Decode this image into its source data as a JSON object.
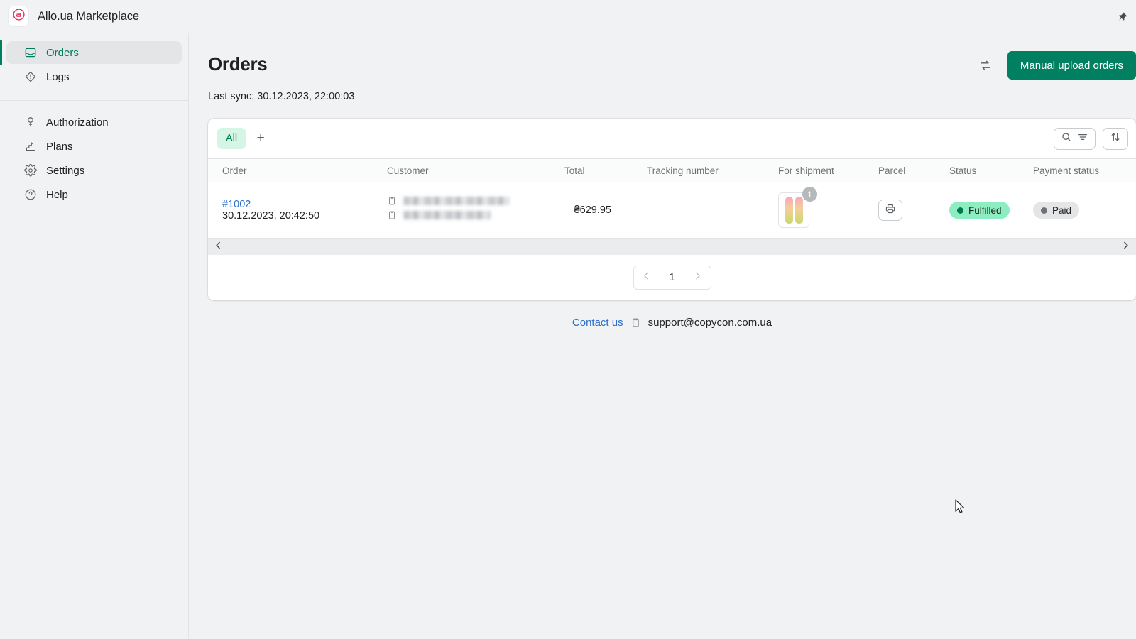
{
  "topbar": {
    "app_title": "Allo.ua Marketplace",
    "logo_icon": "allo-logo-icon",
    "logo_color": "#e8274b",
    "pin_icon": "pushpin-icon"
  },
  "sidebar": {
    "groups": [
      {
        "items": [
          {
            "label": "Orders",
            "icon": "inbox-icon",
            "active": true
          },
          {
            "label": "Logs",
            "icon": "alert-diamond-icon",
            "active": false
          }
        ]
      },
      {
        "items": [
          {
            "label": "Authorization",
            "icon": "key-icon",
            "active": false
          },
          {
            "label": "Plans",
            "icon": "stairs-chart-icon",
            "active": false
          },
          {
            "label": "Settings",
            "icon": "gear-icon",
            "active": false
          },
          {
            "label": "Help",
            "icon": "question-circle-icon",
            "active": false
          }
        ]
      }
    ],
    "accent_color": "#007f5f"
  },
  "page": {
    "title": "Orders",
    "last_sync": "Last sync: 30.12.2023, 22:00:03",
    "sync_icon": "sync-arrows-icon",
    "primary_button": "Manual upload orders",
    "primary_color": "#008060"
  },
  "tabs": {
    "items": [
      {
        "label": "All",
        "active": true
      }
    ],
    "add_label": "+",
    "search_icon": "search-icon",
    "filter_icon": "filter-lines-icon",
    "sort_icon": "sort-arrows-icon"
  },
  "table": {
    "columns": [
      "Order",
      "Customer",
      "Total",
      "Tracking number",
      "For shipment",
      "Parcel",
      "Status",
      "Payment status"
    ],
    "rows": [
      {
        "order_id": "#1002",
        "order_date": "30.12.2023, 20:42:50",
        "customer_name_redacted": true,
        "customer_contact_redacted": true,
        "total": "₴629.95",
        "tracking_redacted": true,
        "shipment_count": "1",
        "parcel_icon": "printer-icon",
        "status": "Fulfilled",
        "status_color": "#8ceec0",
        "payment_status": "Paid",
        "payment_color": "#e4e5e7",
        "copy_icon": "copy-clipboard-icon"
      }
    ],
    "scroll_left_icon": "chevron-left-icon",
    "scroll_right_icon": "chevron-right-icon"
  },
  "pagination": {
    "prev_icon": "chevron-left-icon",
    "next_icon": "chevron-right-icon",
    "current_page": "1"
  },
  "footer": {
    "contact_link": "Contact us",
    "copy_icon": "copy-clipboard-icon",
    "email": "support@copycon.com.ua"
  }
}
